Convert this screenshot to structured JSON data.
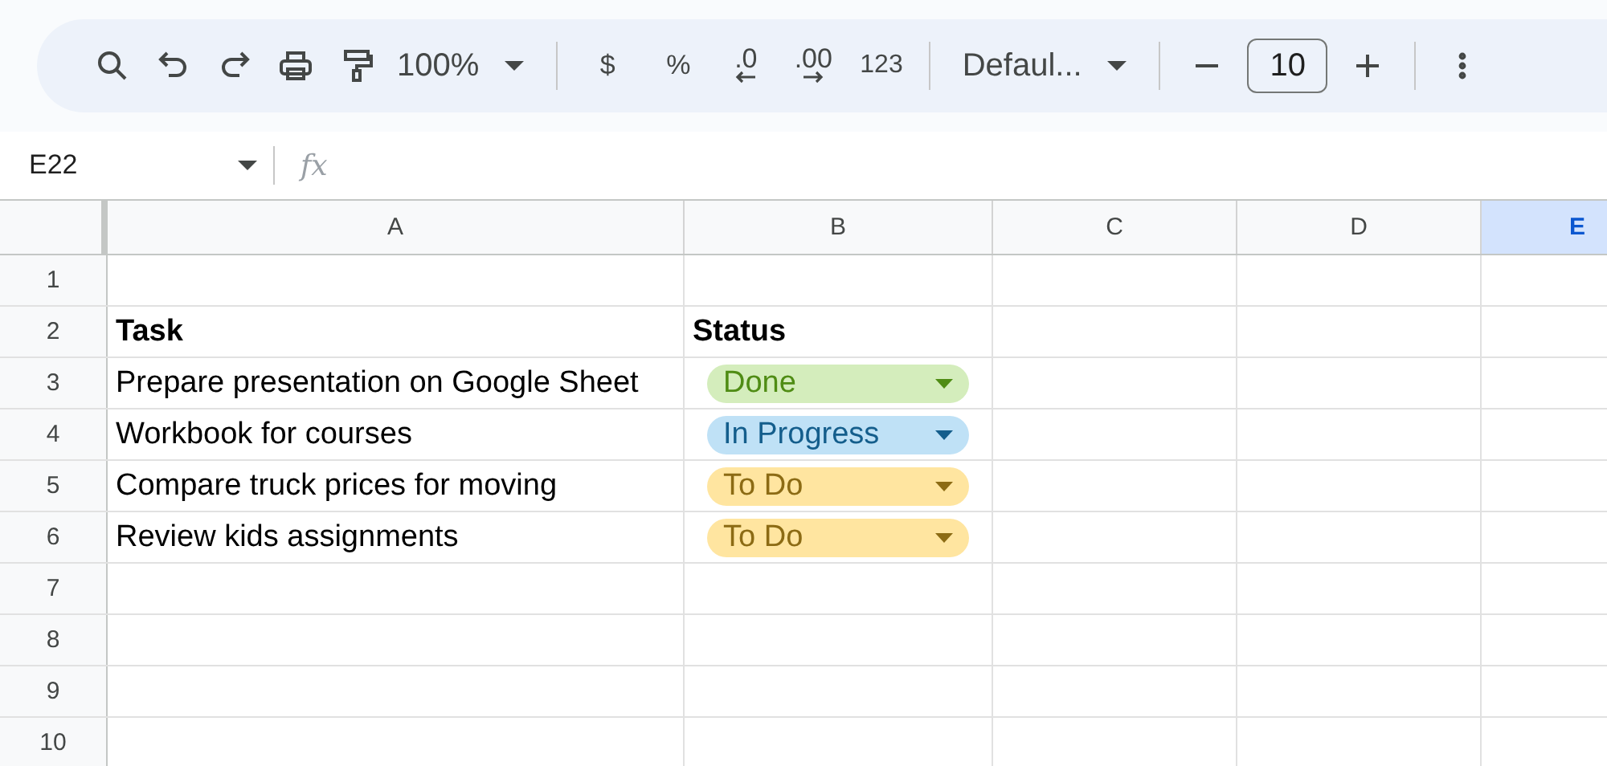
{
  "toolbar": {
    "zoom": "100%",
    "currency": "$",
    "percent": "%",
    "decrease_decimals": ".0",
    "increase_decimals": ".00",
    "number_format": "123",
    "font": "Defaul...",
    "font_size": "10"
  },
  "formula_bar": {
    "cell_ref": "E22",
    "fx": "fx"
  },
  "columns": [
    {
      "label": "A",
      "selected": false
    },
    {
      "label": "B",
      "selected": false
    },
    {
      "label": "C",
      "selected": false
    },
    {
      "label": "D",
      "selected": false
    },
    {
      "label": "E",
      "selected": true
    }
  ],
  "rows": [
    {
      "number": "1",
      "cells": []
    },
    {
      "number": "2",
      "cells": [
        {
          "text": "Task",
          "kind": "header"
        },
        {
          "text": "Status",
          "kind": "header"
        }
      ]
    },
    {
      "number": "3",
      "cells": [
        {
          "text": "Prepare presentation on Google Sheet",
          "kind": "text"
        },
        {
          "text": "Done",
          "kind": "chip",
          "color": "#d4edbc"
        }
      ]
    },
    {
      "number": "4",
      "cells": [
        {
          "text": "Workbook for courses",
          "kind": "text"
        },
        {
          "text": "In Progress",
          "kind": "chip",
          "color": "#bfe1f6"
        }
      ]
    },
    {
      "number": "5",
      "cells": [
        {
          "text": "Compare truck prices for moving",
          "kind": "text"
        },
        {
          "text": "To Do",
          "kind": "chip",
          "color": "#ffe5a0"
        }
      ]
    },
    {
      "number": "6",
      "cells": [
        {
          "text": "Review kids assignments",
          "kind": "text"
        },
        {
          "text": "To Do",
          "kind": "chip",
          "color": "#ffe5a0"
        }
      ]
    },
    {
      "number": "7",
      "cells": []
    },
    {
      "number": "8",
      "cells": []
    },
    {
      "number": "9",
      "cells": []
    },
    {
      "number": "10",
      "cells": []
    }
  ]
}
